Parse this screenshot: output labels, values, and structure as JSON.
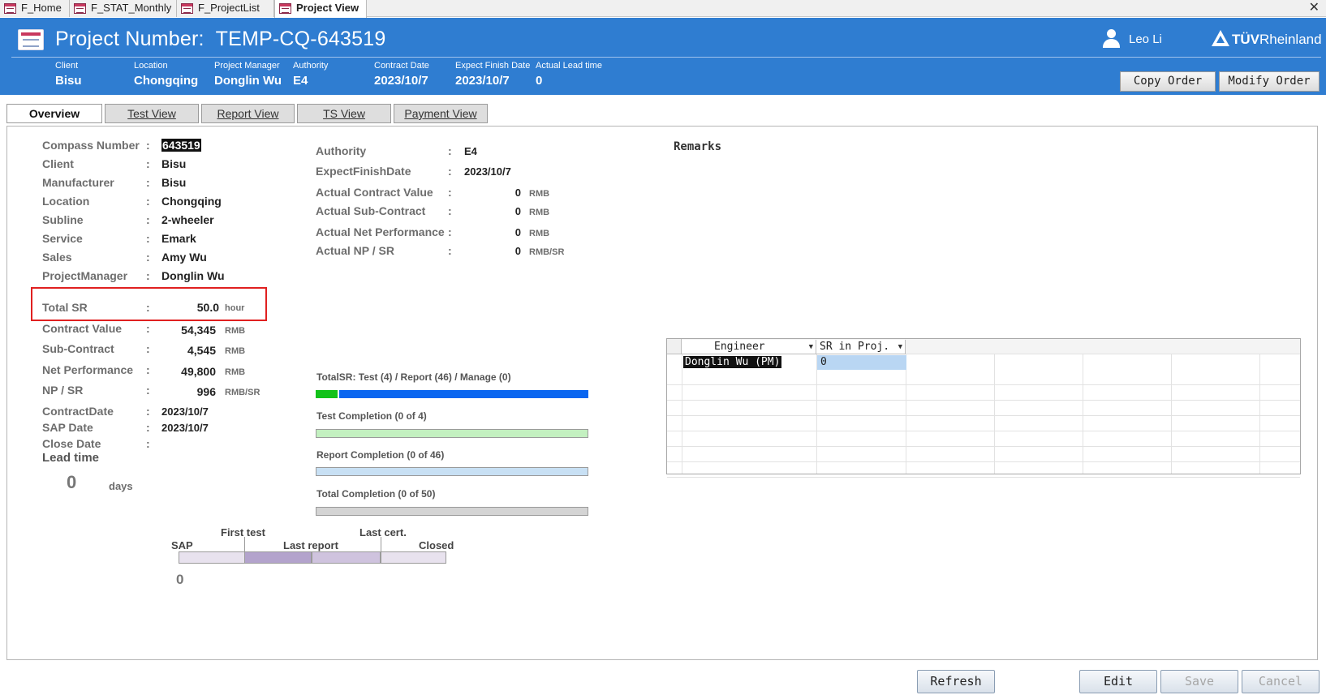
{
  "doc_tabs": [
    {
      "label": "F_Home",
      "active": false
    },
    {
      "label": "F_STAT_Monthly",
      "active": false
    },
    {
      "label": "F_ProjectList",
      "active": false
    },
    {
      "label": "Project View",
      "active": true
    }
  ],
  "close_glyph": "✕",
  "header": {
    "title_prefix": "Project Number:",
    "project_number": "TEMP-CQ-643519",
    "user": "Leo Li",
    "brand_bold": "TÜV",
    "brand_rest": "Rheinland",
    "info": [
      {
        "label": "Client",
        "value": "Bisu"
      },
      {
        "label": "Location",
        "value": "Chongqing"
      },
      {
        "label": "Project Manager",
        "value": "Donglin Wu"
      },
      {
        "label": "Authority",
        "value": "E4"
      },
      {
        "label": "Contract Date",
        "value": "2023/10/7"
      },
      {
        "label": "Expect Finish Date",
        "value": "2023/10/7"
      },
      {
        "label": "Actual Lead time",
        "value": "0"
      }
    ],
    "copy_order": "Copy Order",
    "modify_order": "Modify Order"
  },
  "view_tabs": [
    {
      "label": "Overview",
      "active": true
    },
    {
      "label": "Test View",
      "active": false
    },
    {
      "label": "Report View",
      "active": false
    },
    {
      "label": "TS View",
      "active": false
    },
    {
      "label": "Payment View",
      "active": false
    }
  ],
  "colon": ":",
  "left_fields": [
    {
      "label": "Compass Number",
      "value": "643519"
    },
    {
      "label": "Client",
      "value": "Bisu"
    },
    {
      "label": "Manufacturer",
      "value": "Bisu"
    },
    {
      "label": "Location",
      "value": "Chongqing"
    },
    {
      "label": "Subline",
      "value": "2-wheeler"
    },
    {
      "label": "Service",
      "value": "Emark"
    },
    {
      "label": "Sales",
      "value": "Amy Wu"
    },
    {
      "label": "ProjectManager",
      "value": "Donglin Wu"
    }
  ],
  "money_fields": [
    {
      "label": "Total SR",
      "value": "50.0",
      "unit": "hour"
    },
    {
      "label": "Contract Value",
      "value": "54,345",
      "unit": "RMB"
    },
    {
      "label": "Sub-Contract",
      "value": "4,545",
      "unit": "RMB"
    },
    {
      "label": "Net Performance",
      "value": "49,800",
      "unit": "RMB"
    },
    {
      "label": "NP / SR",
      "value": "996",
      "unit": "RMB/SR"
    }
  ],
  "date_fields": [
    {
      "label": "ContractDate",
      "value": "2023/10/7"
    },
    {
      "label": "SAP Date",
      "value": "2023/10/7"
    },
    {
      "label": "Close Date",
      "value": ""
    }
  ],
  "lead_time": {
    "label": "Lead time",
    "value": "0",
    "unit": "days"
  },
  "mid_fields": [
    {
      "label": "Authority",
      "value": "E4",
      "unit": ""
    },
    {
      "label": "ExpectFinishDate",
      "value": "2023/10/7",
      "unit": ""
    },
    {
      "label": "Actual Contract Value",
      "value": "0",
      "unit": "RMB"
    },
    {
      "label": "Actual Sub-Contract",
      "value": "0",
      "unit": "RMB"
    },
    {
      "label": "Actual Net Performance",
      "value": "0",
      "unit": "RMB"
    },
    {
      "label": "Actual NP / SR",
      "value": "0",
      "unit": "RMB/SR"
    }
  ],
  "remarks_label": "Remarks",
  "progress": {
    "total_sr": {
      "caption": "TotalSR: Test (4) / Report (46) / Manage (0)",
      "test": 4,
      "report": 46,
      "manage": 0,
      "test_color": "#12c21a",
      "report_color": "#0a66f0"
    },
    "test_completion": {
      "caption": "Test Completion (0 of 4)",
      "done": 0,
      "total": 4,
      "color": "#c3f0c0"
    },
    "report_completion": {
      "caption": "Report Completion (0 of 46)",
      "done": 0,
      "total": 46,
      "color": "#c8e0f4"
    },
    "total_completion": {
      "caption": "Total Completion (0 of 50)",
      "done": 0,
      "total": 50,
      "color": "#d4d4d4"
    }
  },
  "timeline": {
    "labels": [
      "SAP",
      "First test",
      "Last report",
      "Last cert.",
      "Closed"
    ],
    "value": "0"
  },
  "engineer_grid": {
    "col_engineer": "Engineer",
    "col_sr": "SR in Proj.",
    "rows": [
      {
        "engineer": "Donglin Wu (PM)",
        "sr": "0"
      }
    ]
  },
  "buttons": {
    "refresh": "Refresh",
    "edit": "Edit",
    "save": "Save",
    "cancel": "Cancel"
  }
}
